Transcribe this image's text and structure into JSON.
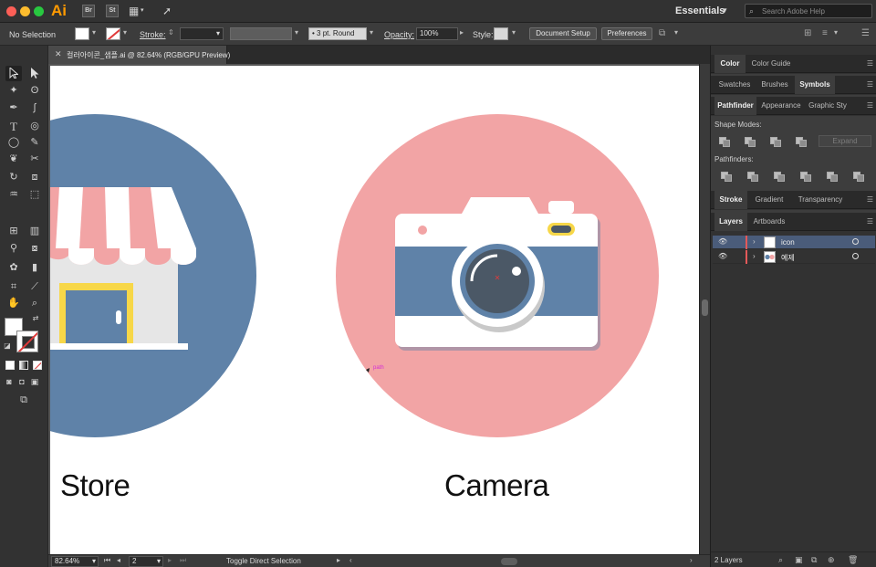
{
  "app": {
    "logo": "Ai",
    "bridge": "Br",
    "stock": "St",
    "workspace": "Essentials",
    "search_placeholder": "Search Adobe Help"
  },
  "control_bar": {
    "selection": "No Selection",
    "stroke_label": "Stroke:",
    "brush": "3 pt. Round",
    "opacity_label": "Opacity:",
    "opacity_value": "100%",
    "style_label": "Style:",
    "document_setup": "Document Setup",
    "preferences": "Preferences"
  },
  "document": {
    "tab_title": "컬러아이콘_샘플.ai @ 82.64% (RGB/GPU Preview)"
  },
  "canvas": {
    "label_store": "Store",
    "label_camera": "Camera",
    "path_tag": "path",
    "colors": {
      "blue": "#5f82a8",
      "pink": "#f2a4a5",
      "yellow": "#f7d748",
      "gray": "#e6e6e6",
      "lens": "#4b5866"
    }
  },
  "status_bar": {
    "zoom": "82.64%",
    "page": "2",
    "status": "Toggle Direct Selection"
  },
  "panels": {
    "row1": [
      "Color",
      "Color Guide"
    ],
    "row2": [
      "Swatches",
      "Brushes",
      "Symbols"
    ],
    "row3": [
      "Pathfinder",
      "Appearance",
      "Graphic Sty"
    ],
    "shape_modes": "Shape Modes:",
    "pathfinders": "Pathfinders:",
    "expand": "Expand",
    "row4": [
      "Stroke",
      "Gradient",
      "Transparency"
    ],
    "row5": [
      "Layers",
      "Artboards"
    ],
    "layers": [
      {
        "name": "icon",
        "color": "#e35959"
      },
      {
        "name": "예제",
        "color": "#e35959"
      }
    ],
    "layer_count": "2 Layers"
  }
}
